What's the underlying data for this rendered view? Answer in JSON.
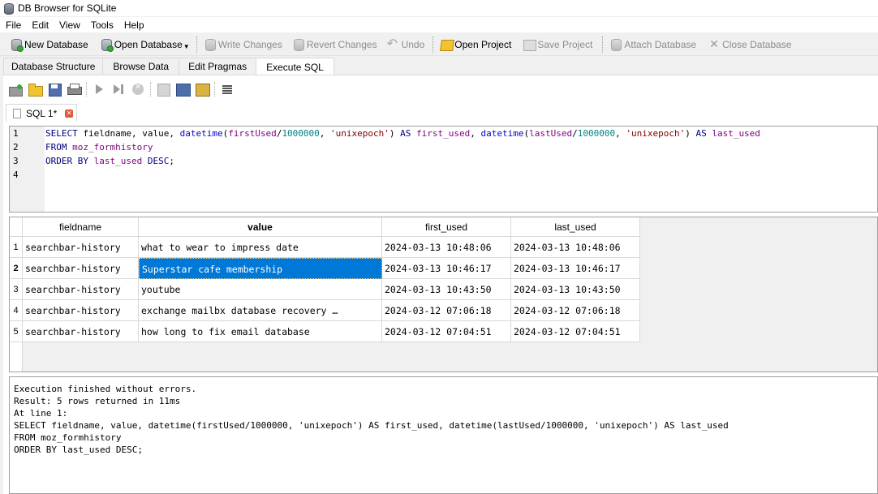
{
  "window": {
    "title": "DB Browser for SQLite"
  },
  "menu": {
    "items": [
      "File",
      "Edit",
      "View",
      "Tools",
      "Help"
    ]
  },
  "toolbar": {
    "new_database": "New Database",
    "open_database": "Open Database",
    "write_changes": "Write Changes",
    "revert_changes": "Revert Changes",
    "undo": "Undo",
    "open_project": "Open Project",
    "save_project": "Save Project",
    "attach_database": "Attach Database",
    "close_database": "Close Database"
  },
  "tabs": [
    "Database Structure",
    "Browse Data",
    "Edit Pragmas",
    "Execute SQL"
  ],
  "active_tab": "Execute SQL",
  "sql_tab": {
    "label": "SQL 1*"
  },
  "editor": {
    "line_numbers": [
      "1",
      "2",
      "3",
      "4"
    ],
    "line1": {
      "k1": "SELECT",
      "t1": " fieldname, value, ",
      "f1": "datetime",
      "p1": "(",
      "i1": "firstUsed",
      "p2": "/",
      "n1": "1000000",
      "p3": ", ",
      "s1": "'unixepoch'",
      "p4": ") ",
      "k2": "AS",
      "i2": " first_used",
      "p5": ", ",
      "f2": "datetime",
      "p6": "(",
      "i3": "lastUsed",
      "p7": "/",
      "n2": "1000000",
      "p8": ", ",
      "s2": "'unixepoch'",
      "p9": ") ",
      "k3": "AS",
      "i4": " last_used"
    },
    "line2": {
      "k1": "FROM",
      "i1": " moz_formhistory"
    },
    "line3": {
      "k1": "ORDER BY",
      "i1": " last_used",
      "k2": " DESC",
      "p1": ";"
    }
  },
  "results": {
    "columns": [
      "fieldname",
      "value",
      "first_used",
      "last_used"
    ],
    "rows": [
      {
        "num": "1",
        "fieldname": "searchbar-history",
        "value": "what to wear to impress date",
        "first_used": "2024-03-13 10:48:06",
        "last_used": "2024-03-13 10:48:06"
      },
      {
        "num": "2",
        "fieldname": "searchbar-history",
        "value": "Superstar cafe membership",
        "first_used": "2024-03-13 10:46:17",
        "last_used": "2024-03-13 10:46:17"
      },
      {
        "num": "3",
        "fieldname": "searchbar-history",
        "value": "youtube",
        "first_used": "2024-03-13 10:43:50",
        "last_used": "2024-03-13 10:43:50"
      },
      {
        "num": "4",
        "fieldname": "searchbar-history",
        "value": "exchange mailbx database recovery …",
        "first_used": "2024-03-12 07:06:18",
        "last_used": "2024-03-12 07:06:18"
      },
      {
        "num": "5",
        "fieldname": "searchbar-history",
        "value": "how long to fix email database",
        "first_used": "2024-03-12 07:04:51",
        "last_used": "2024-03-12 07:04:51"
      }
    ]
  },
  "output": {
    "lines": [
      "Execution finished without errors.",
      "Result: 5 rows returned in 11ms",
      "At line 1:",
      "SELECT fieldname, value, datetime(firstUsed/1000000, 'unixepoch') AS first_used, datetime(lastUsed/1000000, 'unixepoch') AS last_used",
      "FROM moz_formhistory",
      "ORDER BY last_used DESC;"
    ]
  }
}
